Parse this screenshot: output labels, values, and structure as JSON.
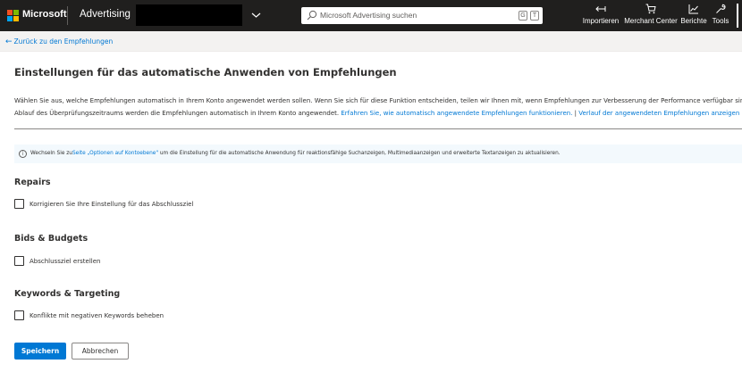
{
  "topbar": {
    "brand": "Microsoft",
    "product": "Advertising",
    "search_placeholder": "Microsoft Advertising suchen",
    "search_key_1": "G",
    "search_key_2": "T",
    "nav": [
      {
        "label": "Importieren",
        "icon": "import-icon"
      },
      {
        "label": "Merchant Center",
        "icon": "cart-icon"
      },
      {
        "label": "Berichte",
        "icon": "chart-icon"
      },
      {
        "label": "Tools",
        "icon": "wrench-icon"
      }
    ],
    "logo_colors": [
      "#f25022",
      "#7fba00",
      "#00a4ef",
      "#ffb900"
    ]
  },
  "backbar": {
    "link": "Zurück zu den Empfehlungen"
  },
  "main": {
    "title": "Einstellungen für das automatische Anwenden von Empfehlungen",
    "desc_line1": "Wählen Sie aus, welche Empfehlungen automatisch in Ihrem Konto angewendet werden sollen. Wenn Sie sich für diese Funktion entscheiden, teilen wir Ihnen mit, wenn Empfehlungen zur Verbesserung der Performance verfügbar sind",
    "desc_line2_text": "Ablauf des Überprüfungszeitraums werden die Empfehlungen automatisch in Ihrem Konto angewendet.",
    "desc_link1": "Erfahren Sie, wie automatisch angewendete Empfehlungen funktionieren.",
    "desc_sep": "|",
    "desc_link2": "Verlauf der angewendeten Empfehlungen anzeigen",
    "info": {
      "prefix": "Wechseln Sie zu",
      "link": "Seite „Optionen auf Kontoebene\"",
      "suffix": "um die Einstellung für die automatische Anwendung für reaktionsfähige Suchanzeigen, Multimediaanzeigen und erweiterte Textanzeigen zu aktualisieren."
    },
    "sections": [
      {
        "title": "Repairs",
        "option": "Korrigieren Sie Ihre Einstellung für das Abschlussziel",
        "checked": false
      },
      {
        "title": "Bids & Budgets",
        "option": "Abschlussziel erstellen",
        "checked": false
      },
      {
        "title": "Keywords & Targeting",
        "option": "Konflikte mit negativen Keywords beheben",
        "checked": false
      }
    ],
    "save_label": "Speichern",
    "cancel_label": "Abbrechen"
  }
}
